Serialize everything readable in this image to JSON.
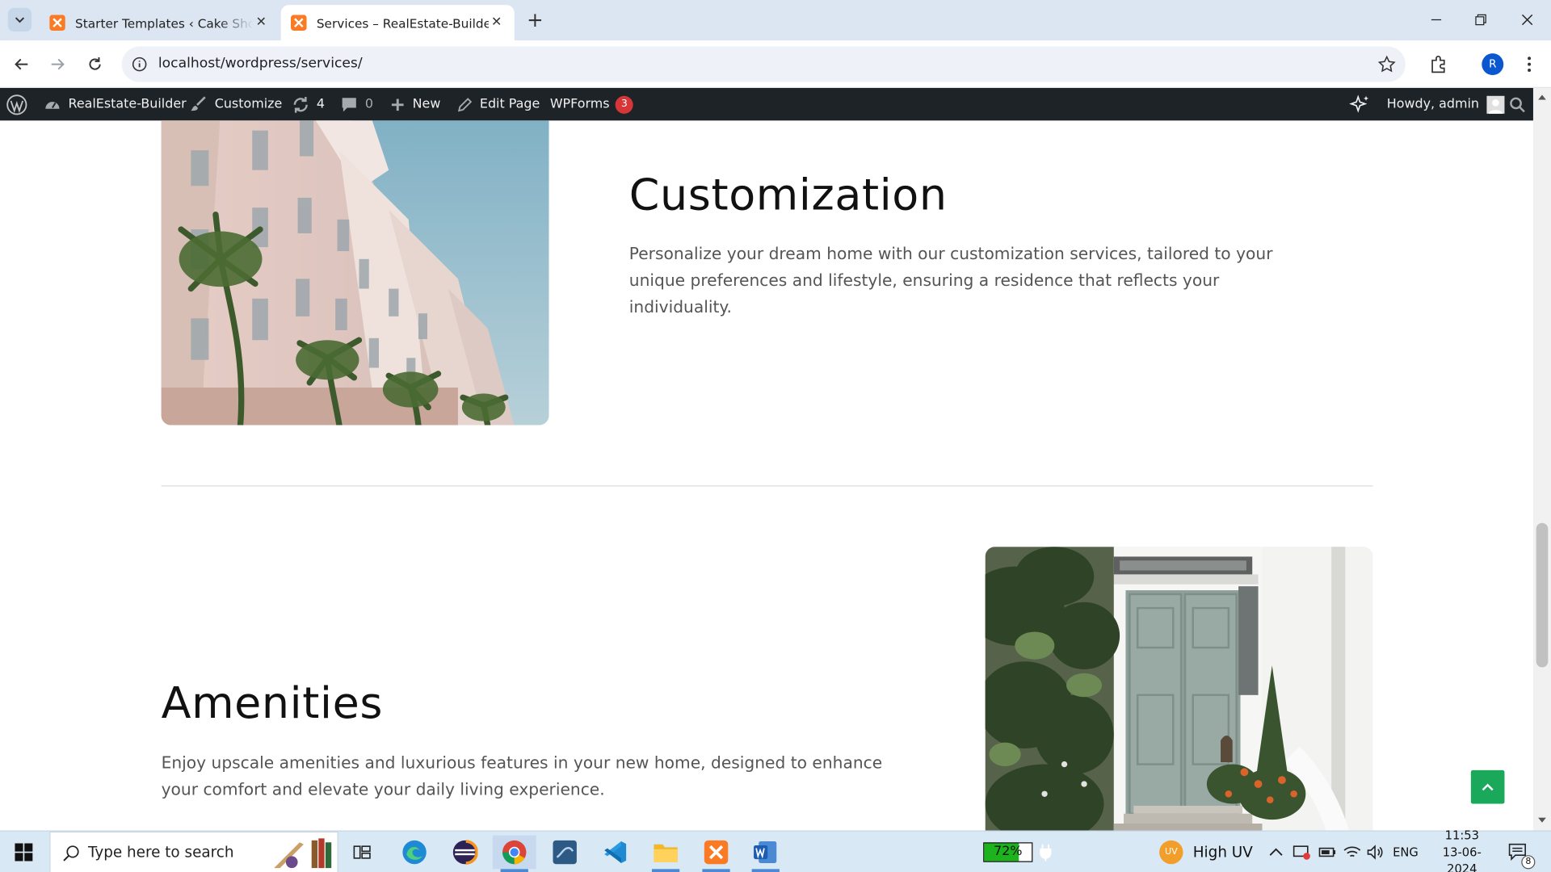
{
  "browser": {
    "tabs": [
      {
        "title": "Starter Templates ‹ Cake Shop – ",
        "active": false
      },
      {
        "title": "Services – RealEstate-Builder",
        "active": true
      }
    ],
    "url": "localhost/wordpress/services/",
    "profile_initial": "R"
  },
  "adminbar": {
    "site_name": "RealEstate-Builder",
    "customize": "Customize",
    "updates_count": "4",
    "comments_count": "0",
    "new_label": "New",
    "edit_page": "Edit Page",
    "wpforms": "WPForms",
    "wpforms_badge": "3",
    "howdy": "Howdy, admin"
  },
  "sections": [
    {
      "heading": "Customization",
      "text": "Personalize your dream home with our customization services, tailored to your unique preferences and lifestyle, ensuring a residence that reflects your individuality.",
      "image": "building-facade-photo"
    },
    {
      "heading": "Amenities",
      "text": "Enjoy upscale amenities and luxurious features in your new home, designed to enhance your comfort and elevate your daily living experience.",
      "image": "front-door-photo"
    }
  ],
  "taskbar": {
    "search_placeholder": "Type here to search",
    "battery": "72%",
    "weather": "High UV",
    "weather_badge": "UV",
    "language": "ENG",
    "time": "11:53",
    "date": "13-06-2024",
    "notifications": "8"
  },
  "colors": {
    "accent_green": "#1aa85a",
    "adminbar_bg": "#1d2327",
    "badge_red": "#d63638"
  }
}
